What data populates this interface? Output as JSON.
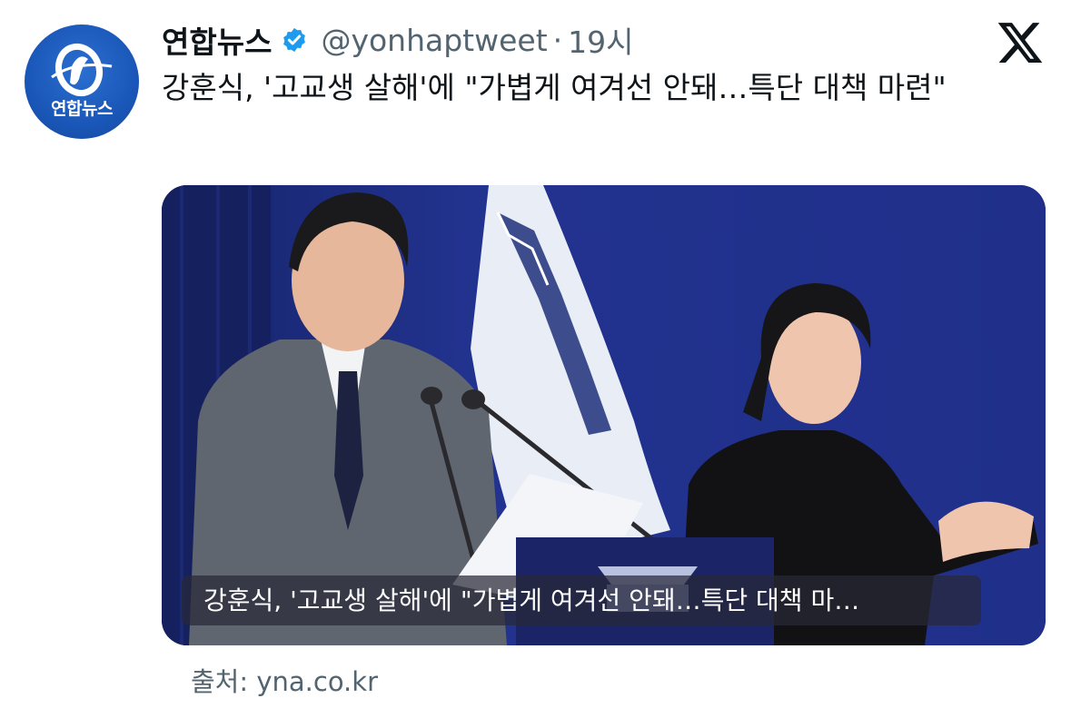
{
  "account": {
    "name": "연합뉴스",
    "handle": "@yonhaptweet",
    "separator": "·",
    "time": "19시",
    "avatar_text": "연합뉴스"
  },
  "tweet": {
    "text": "강훈식, '고교생 살해'에 \"가볍게 여겨선 안돼…특단 대책 마련\""
  },
  "card": {
    "caption": "강훈식, '고교생 살해'에 \"가볍게 여겨선 안돼…특단 대책 마…",
    "source": "출처: yna.co.kr"
  },
  "icons": {
    "verified": "verified-badge-icon",
    "platform": "x-logo-icon"
  },
  "colors": {
    "verified_blue": "#1d9bf0",
    "muted_text": "#536471",
    "brand_blue": "#1a57b8"
  }
}
